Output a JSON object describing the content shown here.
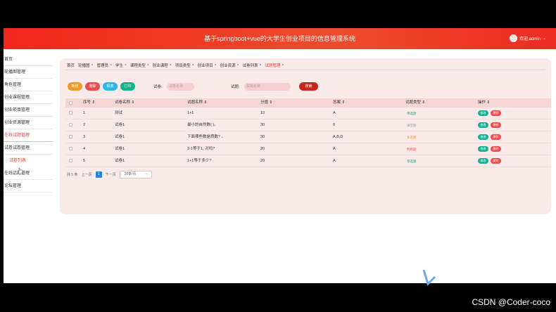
{
  "header": {
    "title": "基于springboot+vue的大学生创业项目的信息管理系统",
    "user_label": "欢迎,admin",
    "dropdown_icon": "chevron-down-icon"
  },
  "sidebar": {
    "items": [
      {
        "label": "首页"
      },
      {
        "label": "轮播图管理"
      },
      {
        "label": "角色管理"
      },
      {
        "label": "创业课程管理"
      },
      {
        "label": "创业项目管理"
      },
      {
        "label": "创业资源管理"
      },
      {
        "label": "在线试题管理"
      },
      {
        "label": "试卷试卷管理"
      },
      {
        "label": "试卷列表"
      },
      {
        "label": "在线话题管理"
      },
      {
        "label": "论坛管理"
      }
    ]
  },
  "tabs": [
    {
      "label": "首页"
    },
    {
      "label": "轮播图"
    },
    {
      "label": "管理员"
    },
    {
      "label": "学生"
    },
    {
      "label": "课程类型"
    },
    {
      "label": "创业课程"
    },
    {
      "label": "项目类型"
    },
    {
      "label": "创业项目"
    },
    {
      "label": "创业资源"
    },
    {
      "label": "试卷列表"
    },
    {
      "label": "试题管理"
    }
  ],
  "toolbar": {
    "add_label": "新增",
    "delete_label": "删除",
    "report_label": "报表",
    "print_label": "打印",
    "paper_label": "试卷:",
    "paper_placeholder": "试卷名称",
    "question_label": "试题:",
    "question_placeholder": "试题名称",
    "search_label": "搜索"
  },
  "table": {
    "headers": [
      "序号",
      "试卷名称",
      "试题名称",
      "分值",
      "答案",
      "试题类型",
      "操作"
    ],
    "rows": [
      {
        "index": "1",
        "paper": "测试",
        "question": "1+1",
        "score": "10",
        "answer": "A",
        "type": "单选题"
      },
      {
        "index": "2",
        "paper": "试卷1",
        "question": "最小的自然数( )。",
        "score": "30",
        "answer": "0",
        "type": "填空题"
      },
      {
        "index": "3",
        "paper": "试卷1",
        "question": "下面哪些数是质数? 。",
        "score": "30",
        "answer": "A,B,D",
        "type": "多选题"
      },
      {
        "index": "4",
        "paper": "试卷1",
        "question": "2-1等于1, 对吗?",
        "score": "20",
        "answer": "A",
        "type": "判断题"
      },
      {
        "index": "5",
        "paper": "试卷1",
        "question": "1+1等于多少?",
        "score": "20",
        "answer": "A",
        "type": "单选题"
      }
    ],
    "action_edit": "修改",
    "action_delete": "删除"
  },
  "pager": {
    "total": "共 5 条",
    "prev": "上一页",
    "current": "1",
    "next": "下一页",
    "page_size": "20条/页"
  },
  "watermark": "CSDN @Coder-coco",
  "colors": {
    "brand": "#ef2f22",
    "add": "#f09a2a",
    "delete": "#ec4d4d",
    "report": "#2bb7e7",
    "print": "#13b289",
    "search": "#cc2418",
    "edit": "#17b191",
    "remove": "#ef4c45"
  }
}
